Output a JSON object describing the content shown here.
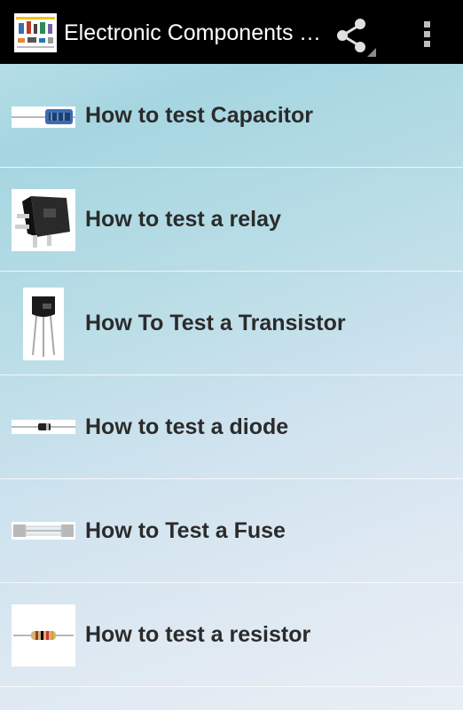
{
  "app_bar": {
    "title": "Electronic Components Tester",
    "share_icon": "share-icon",
    "overflow_icon": "overflow-menu-icon"
  },
  "items": [
    {
      "label": "How to test Capacitor",
      "icon": "capacitor-thumbnail"
    },
    {
      "label": "How to test a relay",
      "icon": "relay-thumbnail"
    },
    {
      "label": "How To Test a Transistor",
      "icon": "transistor-thumbnail"
    },
    {
      "label": "How to test a diode",
      "icon": "diode-thumbnail"
    },
    {
      "label": "How to Test a Fuse",
      "icon": "fuse-thumbnail"
    },
    {
      "label": "How to test a resistor",
      "icon": "resistor-thumbnail"
    }
  ],
  "colors": {
    "action_bar": "#000000",
    "text": "#2b2b2b",
    "background_start": "#a6d6e1",
    "background_end": "#e8eef5"
  }
}
